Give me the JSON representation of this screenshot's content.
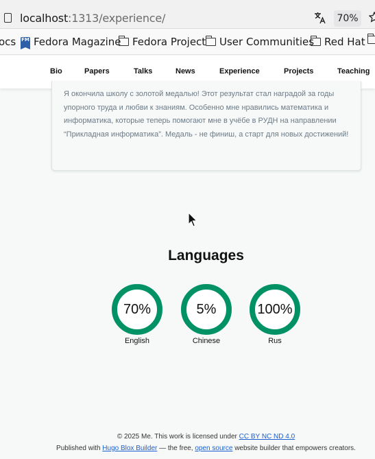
{
  "browser": {
    "url_host": "localhost",
    "url_path": ":1313/experience/",
    "zoom": "70%",
    "icons": {
      "page": "page-icon",
      "translate": "translate-icon",
      "bookmark": "star-icon"
    }
  },
  "bookmarks": [
    {
      "label": "ocs",
      "icon": ""
    },
    {
      "label": "Fedora Magazine",
      "icon": "fedora-magazine-icon"
    },
    {
      "label": "Fedora Project",
      "icon": "folder-icon"
    },
    {
      "label": "User Communities",
      "icon": "folder-icon"
    },
    {
      "label": "Red Hat",
      "icon": "folder-icon"
    }
  ],
  "nav": [
    "Bio",
    "Papers",
    "Talks",
    "News",
    "Experience",
    "Projects",
    "Teaching"
  ],
  "card": {
    "text": "Я окончила школу с золотой медалью! Этот результат стал наградой за годы упорного труда и любви к знаниям. Особенно мне нравились математика и информатика, которые теперь помогают мне в учёбе в РУДН на направлении “Прикладная информатика”. Медаль - не финиш, а старт для новых достижений!"
  },
  "languages": {
    "title": "Languages",
    "color": "#009265",
    "items": [
      {
        "name": "English",
        "percent": "70%"
      },
      {
        "name": "Chinese",
        "percent": "5%"
      },
      {
        "name": "Rus",
        "percent": "100%"
      }
    ]
  },
  "footer": {
    "line1_prefix": "© 2025 Me. This work is licensed under ",
    "license_link": "CC BY NC ND 4.0",
    "line2_prefix": "Published with ",
    "builder_link": "Hugo Blox Builder",
    "line2_middle": " — the free, ",
    "opensource_link": "open source",
    "line2_suffix": " website builder that empowers creators."
  }
}
